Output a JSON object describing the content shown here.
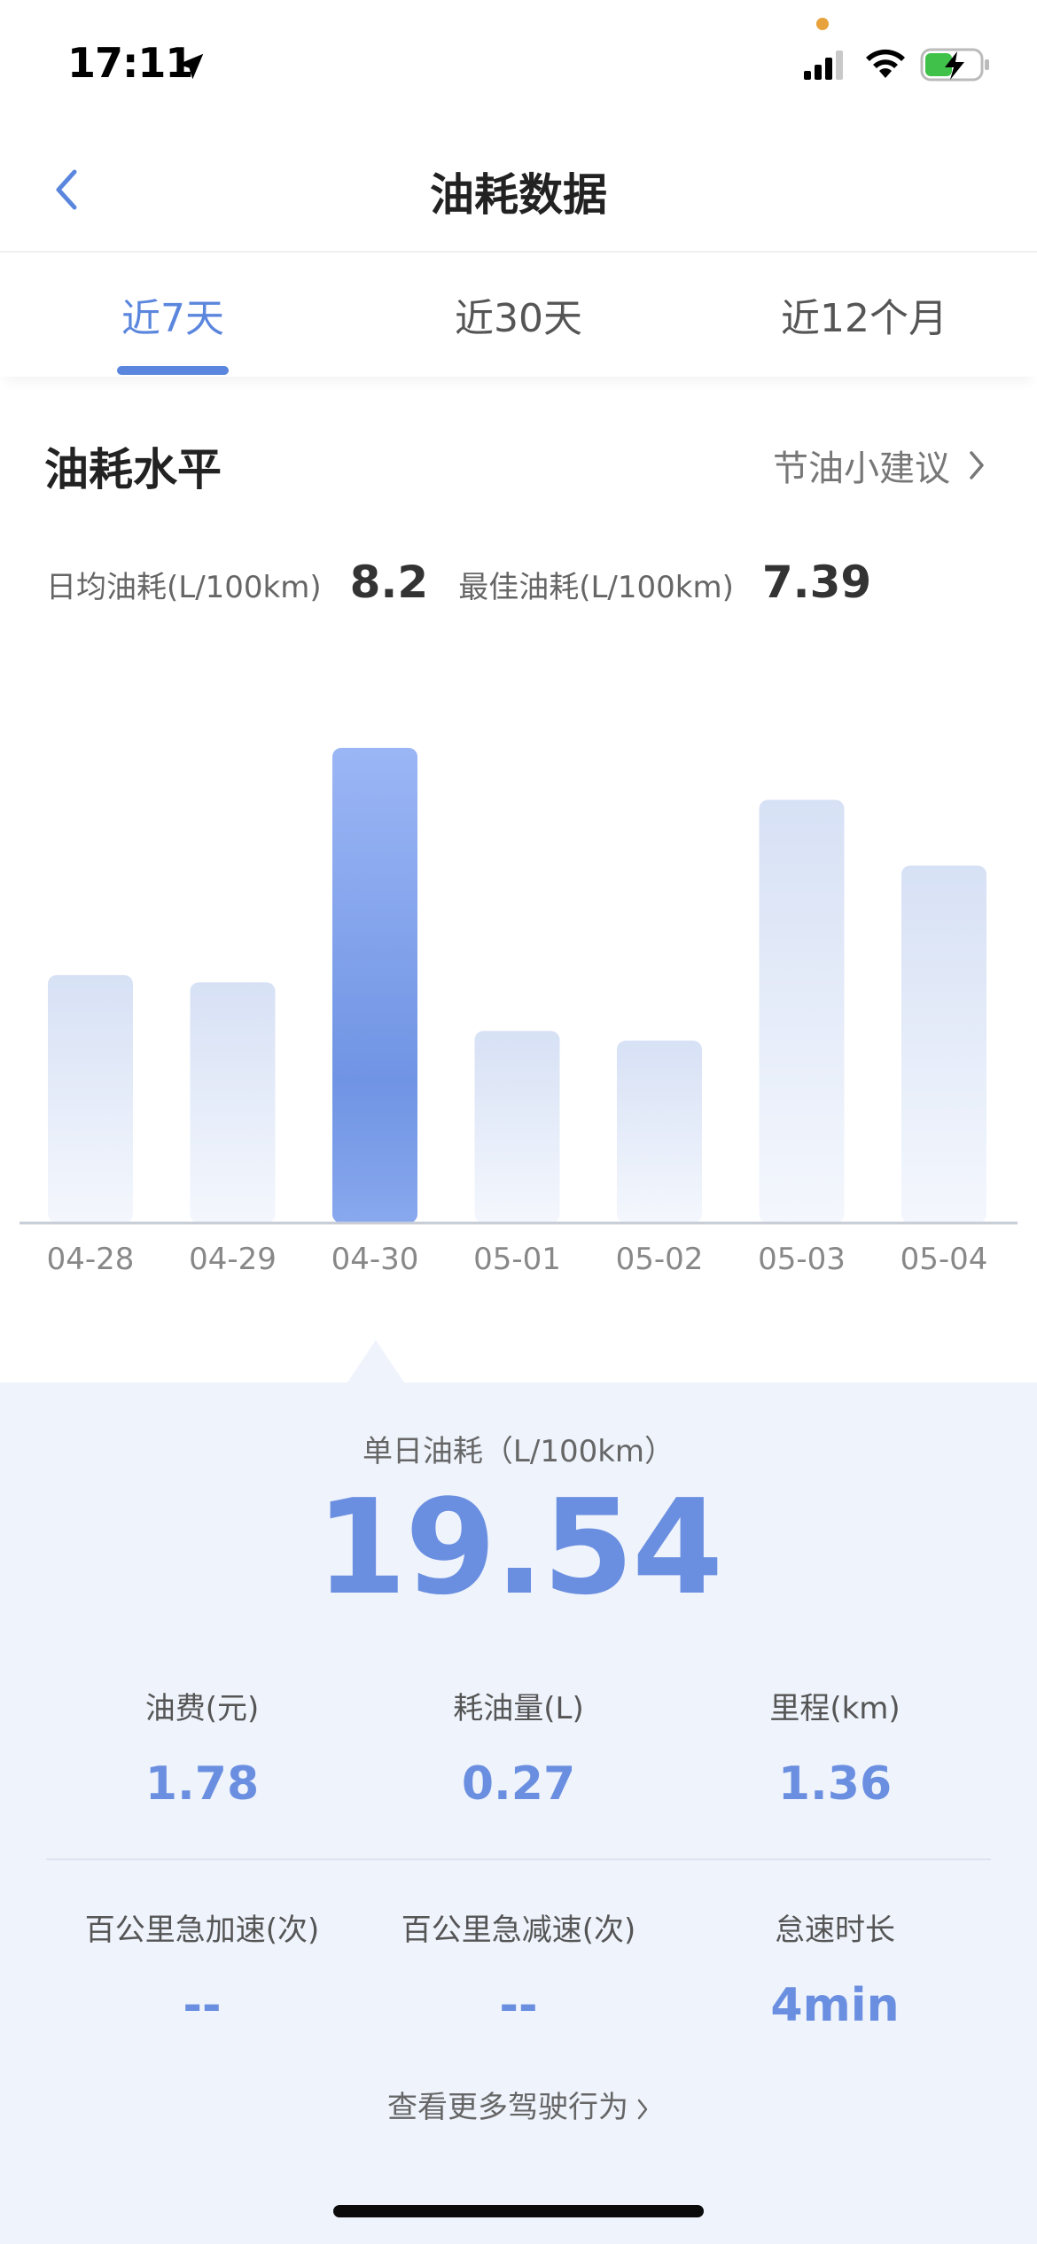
{
  "status_bar": {
    "time": "17:11",
    "icons": [
      "location-arrow-icon",
      "signal-icon",
      "wifi-icon",
      "battery-charging-icon"
    ]
  },
  "nav": {
    "title": "油耗数据",
    "back_icon": "chevron-left-icon"
  },
  "tabs": [
    {
      "label": "近7天",
      "active": true
    },
    {
      "label": "近30天",
      "active": false
    },
    {
      "label": "近12个月",
      "active": false
    }
  ],
  "section": {
    "title": "油耗水平",
    "tips_link": "节油小建议"
  },
  "stats": {
    "avg_label": "日均油耗(L/100km)",
    "avg_value": "8.2",
    "best_label": "最佳油耗(L/100km)",
    "best_value": "7.39"
  },
  "chart_data": {
    "type": "bar",
    "categories": [
      "04-28",
      "04-29",
      "04-30",
      "05-01",
      "05-02",
      "05-03",
      "05-04"
    ],
    "values": [
      10.2,
      9.9,
      19.54,
      7.9,
      7.5,
      17.4,
      14.7
    ],
    "selected_index": 2,
    "ylim": [
      0,
      20
    ],
    "colors": {
      "bar_top": "#d7e1f5",
      "bar_bottom": "#f4f7fd",
      "selected_top": "#9bb6f5",
      "selected_bottom": "#6f93e3",
      "axis": "#c7ccd6"
    }
  },
  "details": {
    "label": "单日油耗（L/100km）",
    "value": "19.54",
    "metrics_row1": [
      {
        "label": "油费(元)",
        "value": "1.78"
      },
      {
        "label": "耗油量(L)",
        "value": "0.27"
      },
      {
        "label": "里程(km)",
        "value": "1.36"
      }
    ],
    "metrics_row2": [
      {
        "label": "百公里急加速(次)",
        "value": "--"
      },
      {
        "label": "百公里急减速(次)",
        "value": "--"
      },
      {
        "label": "怠速时长",
        "value": "4min"
      }
    ],
    "more_link": "查看更多驾驶行为"
  },
  "colors": {
    "accent": "#5b86dd",
    "value_blue": "#6b8fe0",
    "panel_bg": "#eef3fc"
  }
}
